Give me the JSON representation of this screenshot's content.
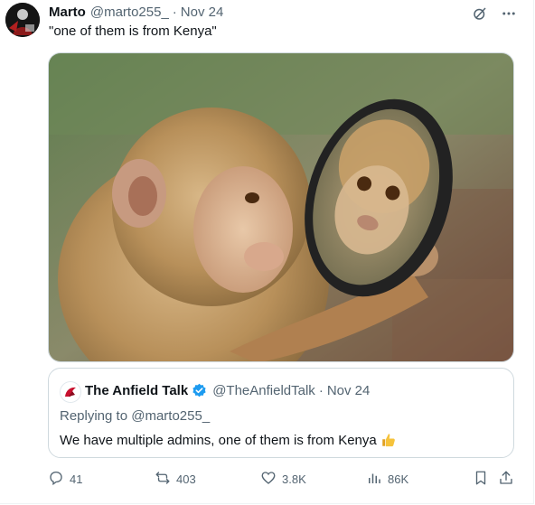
{
  "tweet": {
    "author_name": "Marto",
    "author_handle": "@marto255_",
    "separator": "·",
    "date": "Nov 24",
    "text": "\"one of them is from Kenya\""
  },
  "header_icons": [
    "grok-icon",
    "more-icon"
  ],
  "media": {
    "icon": "monkey-mirror-photo"
  },
  "quote": {
    "author_name": "The Anfield Talk",
    "author_handle": "@TheAnfieldTalk",
    "separator": "·",
    "date": "Nov 24",
    "replying_prefix": "Replying to",
    "replying_to": "@marto255_",
    "text": "We have multiple admins, one of them is from Kenya",
    "verified_color": "#1d9bf0"
  },
  "actions": {
    "replies": "41",
    "reposts": "403",
    "likes": "3.8K",
    "views": "86K"
  },
  "colors": {
    "text_primary": "#0f1419",
    "text_secondary": "#536471",
    "border": "#cfd9de",
    "accent": "#1d9bf0"
  }
}
